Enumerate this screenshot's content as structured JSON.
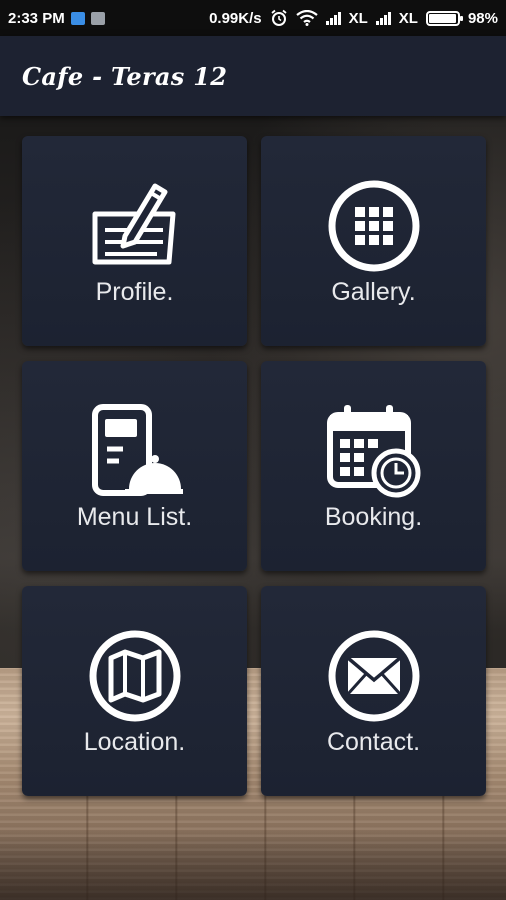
{
  "status_bar": {
    "time": "2:33 PM",
    "speed": "0.99K/s",
    "carrier1": "XL",
    "carrier2": "XL",
    "battery": "98%",
    "battery_level": 0.98
  },
  "app_bar": {
    "title": "Cafe - Teras 12"
  },
  "menu": {
    "profile": "Profile.",
    "gallery": "Gallery.",
    "menu_list": "Menu List.",
    "booking": "Booking.",
    "location": "Location.",
    "contact": "Contact."
  },
  "colors": {
    "tile_bg": "#1f2536",
    "app_bar_bg": "#1d2231",
    "icon": "#ffffff"
  }
}
